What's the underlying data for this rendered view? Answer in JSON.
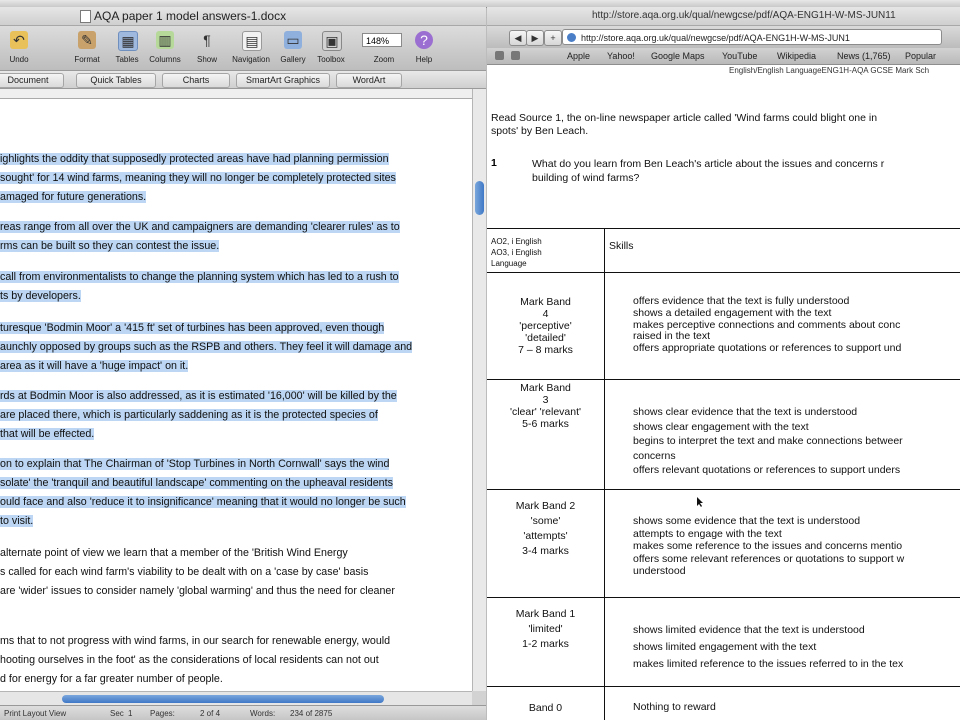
{
  "word": {
    "title": "AQA paper 1 model answers-1.docx",
    "toolbar": [
      {
        "label": "Undo",
        "icon": "undo-icon"
      },
      {
        "label": "Format",
        "icon": "format-brush-icon"
      },
      {
        "label": "Tables",
        "icon": "tables-icon"
      },
      {
        "label": "Columns",
        "icon": "columns-icon"
      },
      {
        "label": "Show",
        "icon": "pilcrow-icon"
      },
      {
        "label": "Navigation",
        "icon": "navigation-icon"
      },
      {
        "label": "Gallery",
        "icon": "gallery-icon"
      },
      {
        "label": "Toolbox",
        "icon": "toolbox-icon"
      },
      {
        "label": "Zoom",
        "icon": "zoom-icon"
      },
      {
        "label": "Help",
        "icon": "help-icon"
      }
    ],
    "zoom_value": "148%",
    "ribbon_tabs": [
      "Document Elements",
      "Quick Tables",
      "Charts",
      "SmartArt Graphics",
      "WordArt"
    ],
    "paragraphs": [
      {
        "selected": true,
        "lines": [
          "ighlights the oddity that supposedly protected areas have had planning permission",
          "sought' for 14 wind farms, meaning they will no longer be completely protected sites",
          "amaged for future generations."
        ]
      },
      {
        "selected": true,
        "lines": [
          "reas range from all over the UK and campaigners are demanding 'clearer rules' as to",
          "rms can be built so they can contest the issue."
        ]
      },
      {
        "selected": true,
        "lines": [
          "call from environmentalists to change the planning system which has led to a rush to",
          "ts by developers."
        ]
      },
      {
        "selected": true,
        "lines": [
          "turesque 'Bodmin Moor' a '415 ft' set of turbines has been approved, even though",
          "aunchly opposed by groups such as the RSPB and others. They feel it will damage and",
          "area as it will have a 'huge impact' on it."
        ]
      },
      {
        "selected": true,
        "lines": [
          "rds at Bodmin Moor is also addressed, as it is estimated '16,000' will be killed by the",
          "are placed there, which is particularly saddening as it is the protected species of",
          "that will be effected."
        ]
      },
      {
        "selected": true,
        "lines": [
          "on to explain that The Chairman of 'Stop Turbines in North Cornwall' says the wind",
          "solate' the 'tranquil and beautiful landscape' commenting on the upheaval residents",
          "ould face and also 'reduce it to insignificance' meaning that it would no longer be such",
          "to visit."
        ]
      },
      {
        "selected": false,
        "lines": [
          "alternate point of view we learn that a member of the 'British Wind Energy",
          "s called for each wind farm's viability to be dealt with on a 'case by case' basis",
          "are 'wider' issues to consider namely 'global warming' and thus the need for cleaner"
        ]
      },
      {
        "selected": false,
        "lines": [
          "ms that to not progress with wind farms, in our search for renewable energy, would",
          "hooting ourselves in the foot' as the considerations of local residents can not out",
          "d for energy for a far greater number of people."
        ]
      }
    ],
    "status": {
      "view": "Print Layout View",
      "sec": "Sec",
      "sec_val": "1",
      "pages": "Pages:",
      "pages_val": "2 of 4",
      "words": "Words:",
      "words_val": "234 of 2875"
    }
  },
  "browser": {
    "title": "http://store.aqa.org.uk/qual/newgcse/pdf/AQA-ENG1H-W-MS-JUN11",
    "url": "http://store.aqa.org.uk/qual/newgcse/pdf/AQA-ENG1H-W-MS-JUN1",
    "bookmarks": [
      "Apple",
      "Yahoo!",
      "Google Maps",
      "YouTube",
      "Wikipedia",
      "News (1,765)",
      "Popular"
    ],
    "doc_header": "English/English LanguageENG1H-AQA GCSE Mark Sch",
    "intro_lines": [
      "Read Source 1, the on-line newspaper article called 'Wind farms could blight one in",
      "spots' by Ben Leach."
    ],
    "question_number": "1",
    "question_lines": [
      "What do you learn from Ben Leach's article about the issues and concerns r",
      "building of wind farms?"
    ],
    "table": {
      "ao_lines": [
        "AO2, i English",
        "AO3, i English",
        "Language"
      ],
      "skills_header": "Skills",
      "bands": [
        {
          "lines": [
            "Mark Band",
            "4",
            "'perceptive'",
            "'detailed'",
            "7 – 8 marks"
          ],
          "skills": [
            "offers  evidence that the text is fully understood",
            "shows a detailed engagement with the text",
            "makes perceptive connections  and comments about conc",
            "raised in the text",
            "offers  appropriate quotations or references to support und"
          ]
        },
        {
          "lines": [
            "Mark Band",
            "3",
            "'clear'  'relevant'",
            "5-6 marks"
          ],
          "skills": [
            "shows clear evidence that the text is understood",
            "shows clear engagement  with the text",
            "begins to interpret the text and make connections betweer",
            "concerns",
            "offers relevant  quotations or references to support unders"
          ]
        },
        {
          "lines": [
            "Mark Band 2",
            "'some'",
            "'attempts'",
            "3-4 marks"
          ],
          "skills": [
            "shows some evidence that the  text is understood",
            "attempts to engage with the text",
            "makes some reference to the issues and concerns mentio",
            " offers some relevant references or quotations to support w",
            "understood"
          ]
        },
        {
          "lines": [
            "Mark Band 1",
            "'limited'",
            "1-2 marks"
          ],
          "skills": [
            "shows limited evidence that the text is understood",
            "shows limited engagement with the text",
            "makes limited reference to the issues referred to in the tex"
          ]
        },
        {
          "lines": [
            "Band 0"
          ],
          "skills": [
            "Nothing to reward"
          ]
        }
      ]
    }
  }
}
